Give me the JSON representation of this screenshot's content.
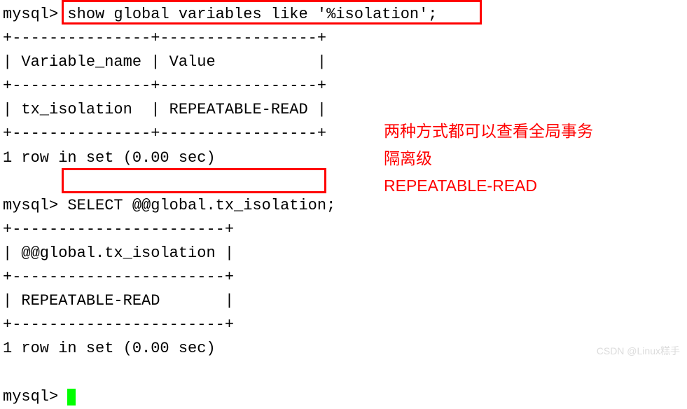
{
  "terminal": {
    "prompt": "mysql>",
    "cmd1": "show global variables like '%isolation';",
    "divider1": "+---------------+-----------------+",
    "header1_col1": "Variable_name",
    "header1_col2": "Value",
    "row1_col1": "tx_isolation",
    "row1_col2": "REPEATABLE-READ",
    "result1": "1 row in set (0.00 sec)",
    "cmd2": "SELECT @@global.tx_isolation;",
    "divider2": "+-----------------------+",
    "header2_col1": "@@global.tx_isolation",
    "row2_col1": "REPEATABLE-READ",
    "result2": "1 row in set (0.00 sec)"
  },
  "annotation": {
    "line1": "两种方式都可以查看全局事务",
    "line2": "隔离级",
    "line3": "REPEATABLE-READ"
  },
  "watermark": "CSDN @Linux糕手"
}
